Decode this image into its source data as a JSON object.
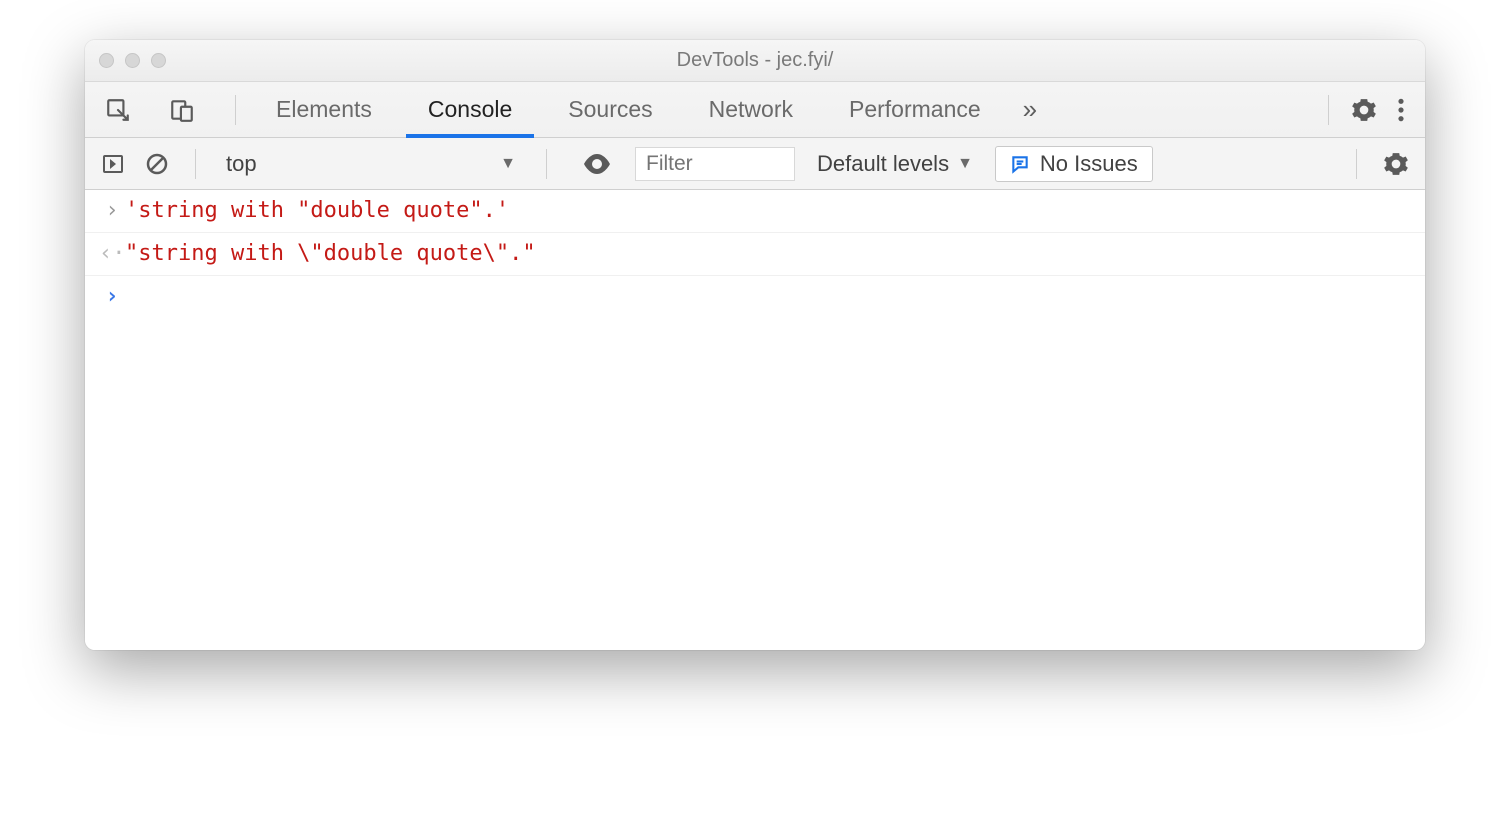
{
  "window": {
    "title": "DevTools - jec.fyi/"
  },
  "tabs": {
    "items": [
      "Elements",
      "Console",
      "Sources",
      "Network",
      "Performance"
    ],
    "active_index": 1
  },
  "toolbar": {
    "context": "top",
    "filter_placeholder": "Filter",
    "levels_label": "Default levels",
    "issues_label": "No Issues"
  },
  "console": {
    "lines": [
      {
        "kind": "input",
        "text": "'string with \"double quote\".'"
      },
      {
        "kind": "output",
        "text": "\"string with \\\"double quote\\\".\""
      }
    ]
  }
}
